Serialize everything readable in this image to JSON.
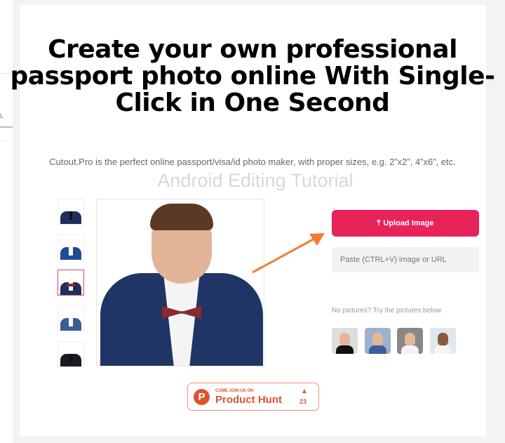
{
  "sidebar": {
    "partial_label": "L"
  },
  "hero": {
    "title": "Create your own professional passport photo online With Single-Click in One Second",
    "subtitle": "Cutout.Pro is the perfect online passport/visa/id photo maker, with proper sizes, e.g. 2”x2”, 4”x6”, etc.",
    "watermark": "Android Editing Tutorial"
  },
  "outfits": {
    "selected_index": 2,
    "items": [
      "navy-suit-tie",
      "blue-suit-open",
      "navy-suit-bowtie",
      "blue-suit-white-shirt",
      "black-suit-tie"
    ]
  },
  "upload": {
    "label": "Upload Image",
    "icon": "upload-icon",
    "color": "#e8235a"
  },
  "paste": {
    "placeholder": "Paste (CTRL+V) image or URL"
  },
  "samples": {
    "prompt": "No pictures? Try the pictures below",
    "items": [
      "woman-glasses",
      "child-curly-hair",
      "boy-white-shirt",
      "boy-vest"
    ]
  },
  "product_hunt": {
    "tagline": "COME JOIN US ON",
    "name": "Product Hunt",
    "votes": "23",
    "color": "#da552f"
  },
  "annotation": {
    "arrow_color": "#f47c30"
  }
}
